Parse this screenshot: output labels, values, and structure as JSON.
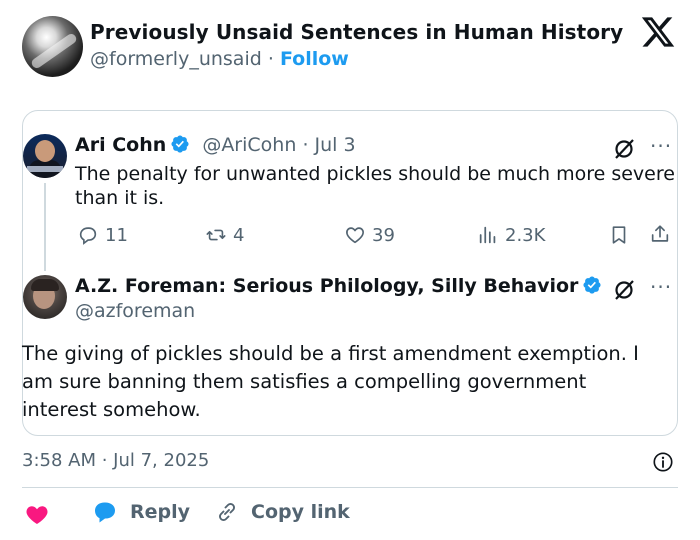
{
  "header": {
    "account_name": "Previously Unsaid Sentences in Human History",
    "handle": "@formerly_unsaid",
    "separator": "·",
    "follow_label": "Follow"
  },
  "quoted_tweet": {
    "author_name": "Ari Cohn",
    "handle": "@AriCohn",
    "separator": "·",
    "date": "Jul 3",
    "text": "The penalty for unwanted pickles should be much more severe than it is.",
    "replies": "11",
    "retweets": "4",
    "likes": "39",
    "views": "2.3K"
  },
  "reply_tweet": {
    "author_name": "A.Z. Foreman: Serious Philology, Silly Behavior",
    "handle": "@azforeman",
    "text": "The giving of pickles should be a first amendment exemption. I am sure banning them satisfies a compelling government interest somehow."
  },
  "footer": {
    "timestamp": "3:58 AM · Jul 7, 2025",
    "reply_label": "Reply",
    "copy_link_label": "Copy link"
  },
  "colors": {
    "accent_blue": "#1d9bf0",
    "heart_pink": "#f91880",
    "muted_text": "#536471",
    "border": "#cfd9de"
  },
  "icons": [
    "x-logo-icon",
    "verified-badge-icon",
    "grok-icon",
    "more-icon",
    "reply-icon",
    "retweet-icon",
    "like-icon",
    "views-icon",
    "bookmark-icon",
    "share-icon",
    "info-icon",
    "heart-icon",
    "comment-bubble-icon",
    "link-icon"
  ]
}
